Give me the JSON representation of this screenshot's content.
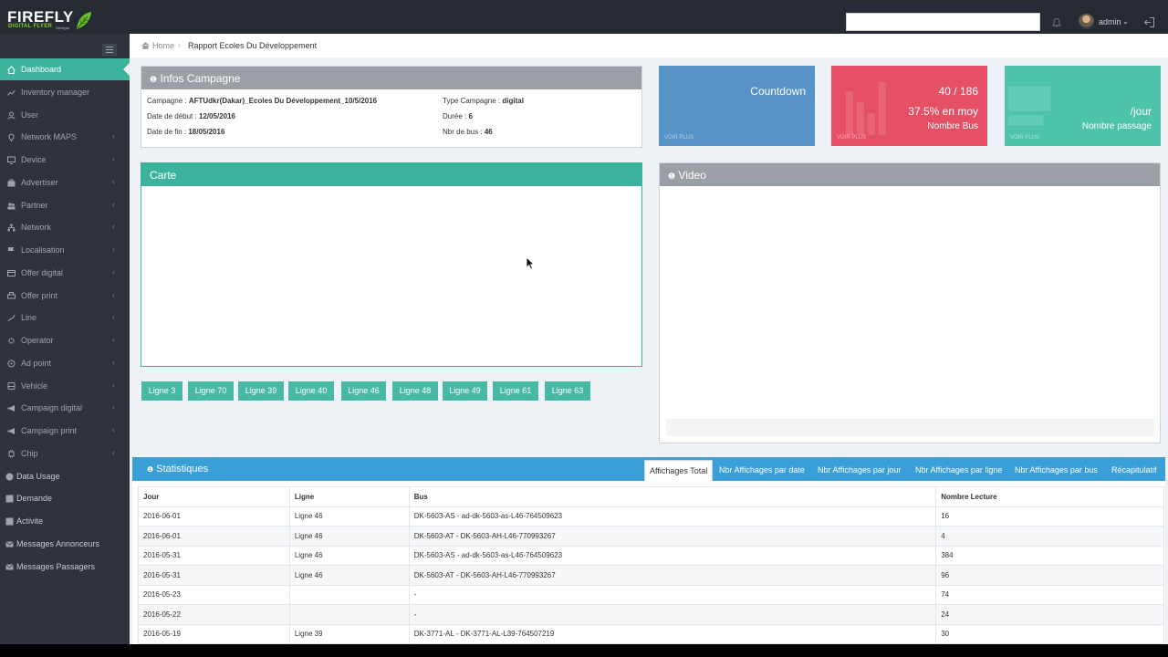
{
  "brand": {
    "name": "FIREFLY",
    "sub": "DIGITAL FLYER",
    "country": "Sénégal"
  },
  "topbar": {
    "user": "admin"
  },
  "sidebar": {
    "items": [
      {
        "label": "Dashboard",
        "icon": "home-icon",
        "active": true,
        "chevron": false
      },
      {
        "label": "Inventory manager",
        "icon": "chart-line-icon",
        "chevron": false
      },
      {
        "label": "User",
        "icon": "user-icon",
        "chevron": false
      },
      {
        "label": "Network MAPS",
        "icon": "map-marker-icon",
        "chevron": true
      },
      {
        "label": "Device",
        "icon": "monitor-icon",
        "chevron": true
      },
      {
        "label": "Advertiser",
        "icon": "briefcase-icon",
        "chevron": true
      },
      {
        "label": "Partner",
        "icon": "users-icon",
        "chevron": true
      },
      {
        "label": "Network",
        "icon": "sitemap-icon",
        "chevron": true
      },
      {
        "label": "Localisation",
        "icon": "flag-icon",
        "chevron": true
      },
      {
        "label": "Offer digital",
        "icon": "credit-card-icon",
        "chevron": true
      },
      {
        "label": "Offer print",
        "icon": "print-icon",
        "chevron": true
      },
      {
        "label": "Line",
        "icon": "route-icon",
        "chevron": true
      },
      {
        "label": "Operator",
        "icon": "settings-icon",
        "chevron": true
      },
      {
        "label": "Ad point",
        "icon": "location-icon",
        "chevron": true
      },
      {
        "label": "Vehicle",
        "icon": "bus-icon",
        "chevron": true
      },
      {
        "label": "Campaign digital",
        "icon": "megaphone-icon",
        "chevron": true
      },
      {
        "label": "Campaign print",
        "icon": "megaphone-icon",
        "chevron": true
      },
      {
        "label": "Chip",
        "icon": "chip-icon",
        "chevron": true
      },
      {
        "label": "Data Usage",
        "icon": "data-icon",
        "chevron": false,
        "plain": true
      },
      {
        "label": "Demande",
        "icon": "list-icon",
        "chevron": false,
        "plain": true
      },
      {
        "label": "Activite",
        "icon": "list-icon",
        "chevron": false,
        "plain": true
      },
      {
        "label": "Messages Annonceurs",
        "icon": "envelope-icon",
        "chevron": false,
        "plain": true
      },
      {
        "label": "Messages Passagers",
        "icon": "envelope-icon",
        "chevron": false,
        "plain": true
      }
    ]
  },
  "breadcrumb": {
    "home": "Home",
    "current": "Rapport Ecoles Du Développement"
  },
  "infos": {
    "title": "Infos Campagne",
    "campagne_label": "Campagne : ",
    "campagne": "AFTUdkr(Dakar)_Ecoles Du Développement_10/5/2016",
    "debut_label": "Date de début : ",
    "debut": "12/05/2016",
    "fin_label": "Date de fin : ",
    "fin": "18/05/2016",
    "type_label": "Type Campagne : ",
    "type": "digital",
    "duree_label": "Durée : ",
    "duree": "6",
    "bus_label": "Nbr de bus : ",
    "bus": "46"
  },
  "stats_cards": [
    {
      "line1": "Countdown",
      "line2": "",
      "line3": "",
      "more": "VOIR PLUS",
      "color": "#5793c6"
    },
    {
      "line1": "40 / 186",
      "line2": "37.5% en moy",
      "line3": "Nombre Bus",
      "more": "VOIR PLUS",
      "color": "#e55065"
    },
    {
      "line1": "",
      "line2": "/jour",
      "line3": "Nombre passage",
      "more": "VOIR PLUS",
      "color": "#4dc4a9"
    }
  ],
  "carte": {
    "title": "Carte"
  },
  "video": {
    "title": "Video"
  },
  "lignes": [
    "Ligne 3",
    "Ligne 70",
    "Ligne 39",
    "Ligne 40",
    "Ligne 46",
    "Ligne 48",
    "Ligne 49",
    "Ligne 61",
    "Ligne 63"
  ],
  "statistiques": {
    "title": "Statistiques",
    "tabs": [
      "Affichages Total",
      "Nbr Affichages par date",
      "Nbr Affichages par jour",
      "Nbr Affichages par ligne",
      "Nbr Affichages par bus",
      "Récapitulatif"
    ],
    "columns": [
      "Jour",
      "Ligne",
      "Bus",
      "Nombre Lecture"
    ],
    "rows": [
      [
        "2016-06-01",
        "Ligne 46",
        "DK-5603-AS - ad-dk-5603-as-L46-764509623",
        "16"
      ],
      [
        "2016-06-01",
        "Ligne 46",
        "DK-5603-AT - DK-5603-AH-L46-770993267",
        "4"
      ],
      [
        "2016-05-31",
        "Ligne 46",
        "DK-5603-AS - ad-dk-5603-as-L46-764509623",
        "384"
      ],
      [
        "2016-05-31",
        "Ligne 46",
        "DK-5603-AT - DK-5603-AH-L46-770993267",
        "96"
      ],
      [
        "2016-05-23",
        "",
        "-",
        "74"
      ],
      [
        "2016-05-22",
        "",
        "-",
        "24"
      ],
      [
        "2016-05-19",
        "Ligne 39",
        "DK-3771-AL - DK-3771-AL-L39-764507219",
        "30"
      ]
    ]
  }
}
